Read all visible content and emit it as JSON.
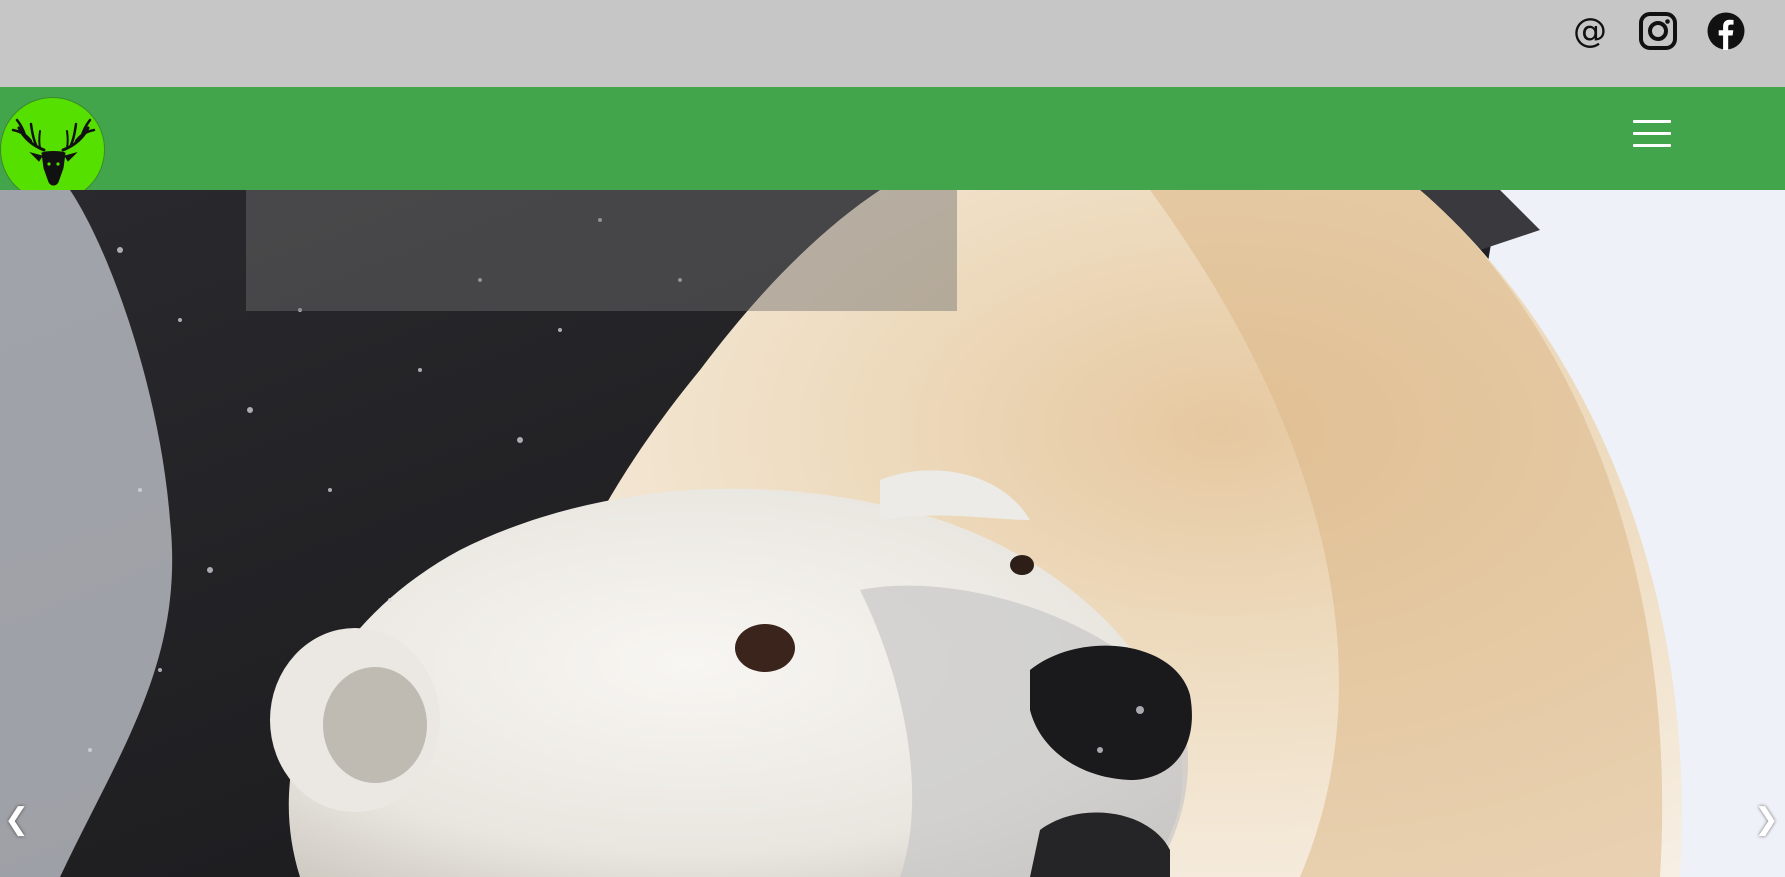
{
  "social": {
    "email_icon": "at-sign-icon",
    "email_glyph": "@",
    "instagram_icon": "instagram-icon",
    "facebook_icon": "facebook-icon"
  },
  "nav": {
    "logo_icon": "deer-head-icon",
    "menu_icon": "hamburger-menu-icon"
  },
  "hero": {
    "image": "polar-bear-in-snow",
    "prev_glyph": "❮",
    "next_glyph": "❯"
  },
  "colors": {
    "topbar": "#c6c6c6",
    "navbar": "#43a54b",
    "logo_bg": "#55e000"
  }
}
